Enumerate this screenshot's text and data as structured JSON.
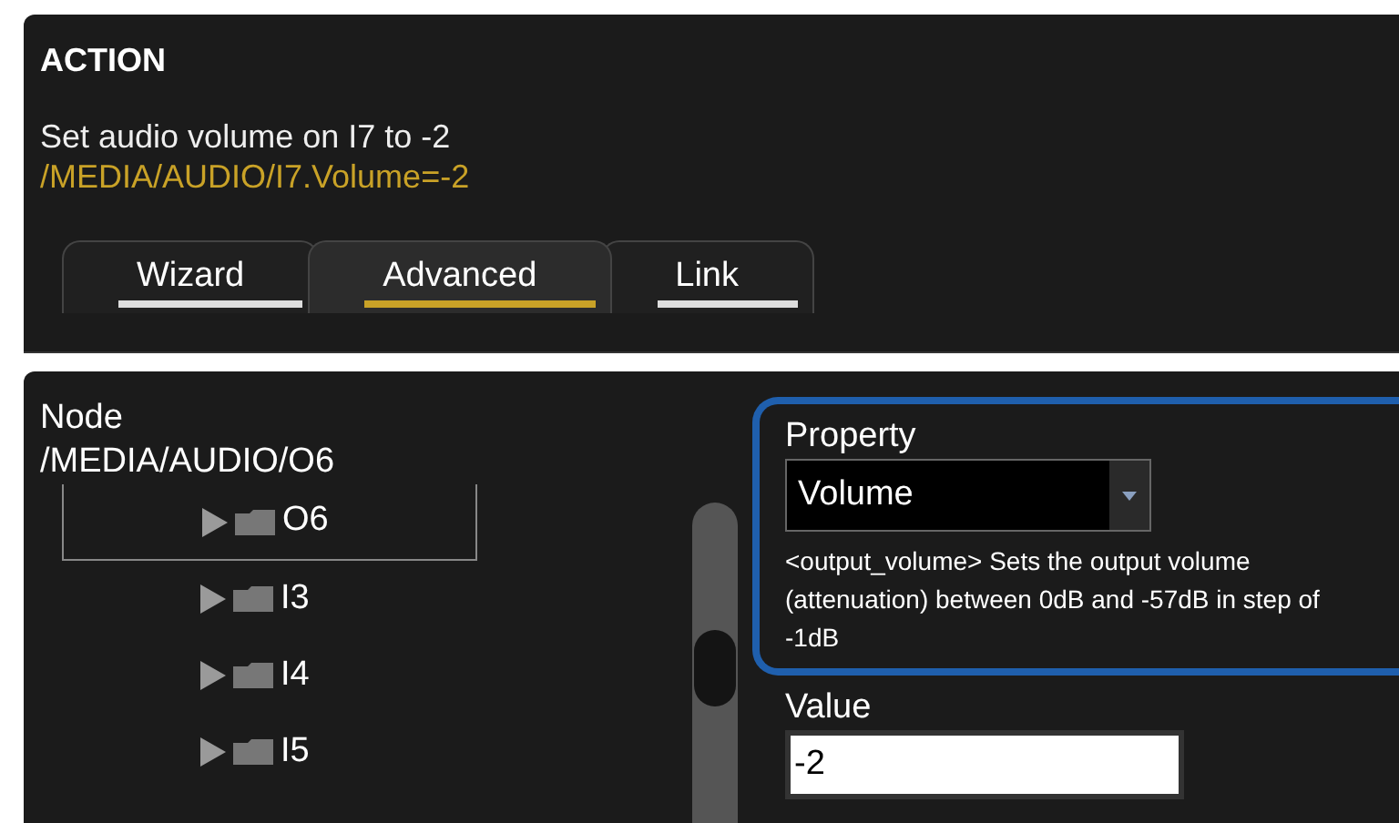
{
  "action": {
    "title": "ACTION",
    "description": "Set audio volume on I7 to -2",
    "command": "/MEDIA/AUDIO/I7.Volume=-2"
  },
  "tabs": [
    {
      "label": "Wizard",
      "selected": false
    },
    {
      "label": "Advanced",
      "selected": true
    },
    {
      "label": "Link",
      "selected": false
    }
  ],
  "node": {
    "label": "Node",
    "path": "/MEDIA/AUDIO/O6",
    "tree": [
      {
        "label": "O6",
        "selected": true
      },
      {
        "label": "I3",
        "selected": false
      },
      {
        "label": "I4",
        "selected": false
      },
      {
        "label": "I5",
        "selected": false
      }
    ]
  },
  "property": {
    "label": "Property",
    "value": "Volume",
    "help": "<output_volume> Sets the output volume (attenuation) between 0dB and -57dB in step of -1dB",
    "highlighted": true
  },
  "value": {
    "label": "Value",
    "value": "-2"
  }
}
